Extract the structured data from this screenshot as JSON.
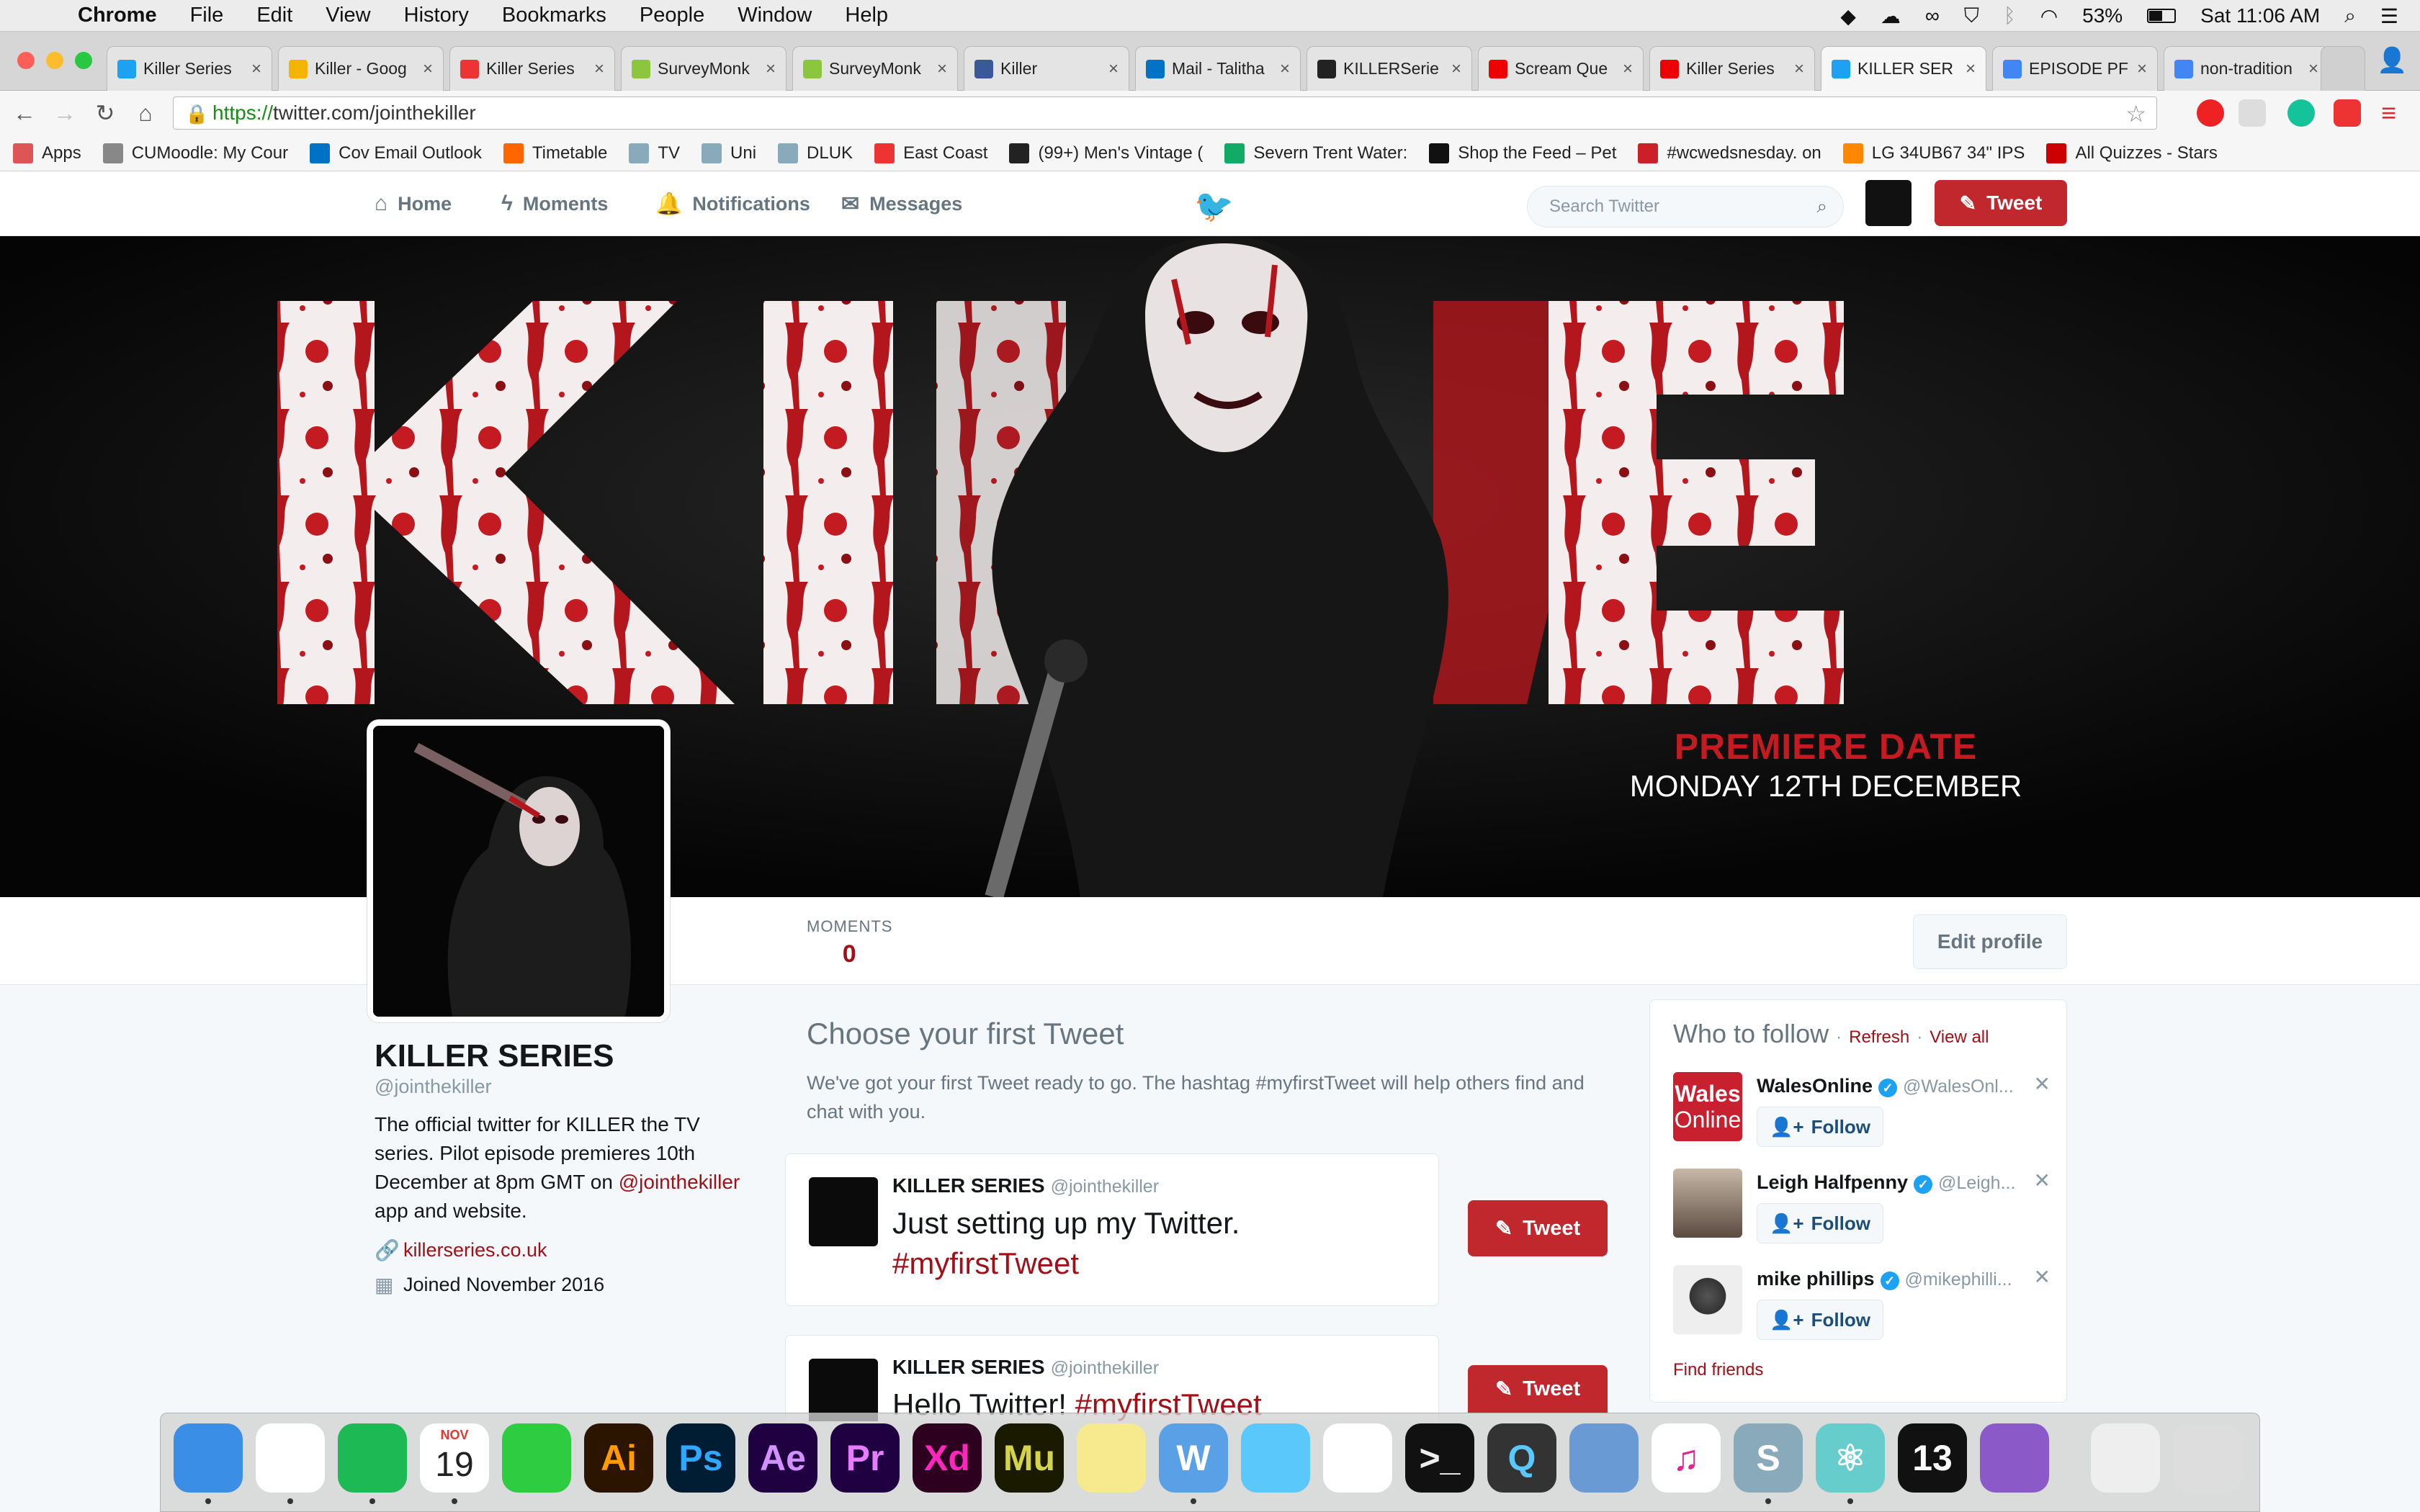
{
  "menubar": {
    "app": "Chrome",
    "items": [
      "File",
      "Edit",
      "View",
      "History",
      "Bookmarks",
      "People",
      "Window",
      "Help"
    ],
    "battery": "53%",
    "clock": "Sat 11:06 AM"
  },
  "tabs": [
    {
      "title": "Killer Series",
      "fav": "#1da1f2"
    },
    {
      "title": "Killer - Goog",
      "fav": "#f4b400"
    },
    {
      "title": "Killer Series",
      "fav": "#e33"
    },
    {
      "title": "SurveyMonk",
      "fav": "#8cc63f"
    },
    {
      "title": "SurveyMonk",
      "fav": "#8cc63f"
    },
    {
      "title": "Killer",
      "fav": "#3b5998"
    },
    {
      "title": "Mail - Talitha",
      "fav": "#0072c6"
    },
    {
      "title": "KILLERSerie",
      "fav": "#222"
    },
    {
      "title": "Scream Que",
      "fav": "#e00"
    },
    {
      "title": "Killer Series",
      "fav": "#e00"
    },
    {
      "title": "KILLER SER",
      "fav": "#1da1f2",
      "active": true
    },
    {
      "title": "EPISODE PF",
      "fav": "#4285f4"
    },
    {
      "title": "non-tradition",
      "fav": "#4285f4"
    }
  ],
  "url": {
    "scheme": "https://",
    "rest": "twitter.com/jointhekiller"
  },
  "bookmarks": [
    {
      "label": "Apps",
      "color": "#d55"
    },
    {
      "label": "CUMoodle: My Cour",
      "color": "#888"
    },
    {
      "label": "Cov Email Outlook",
      "color": "#0072c6"
    },
    {
      "label": "Timetable",
      "color": "#f60"
    },
    {
      "label": "TV",
      "color": "#8ab"
    },
    {
      "label": "Uni",
      "color": "#8ab"
    },
    {
      "label": "DLUK",
      "color": "#8ab"
    },
    {
      "label": "East Coast",
      "color": "#e33"
    },
    {
      "label": "(99+) Men's Vintage (",
      "color": "#222"
    },
    {
      "label": "Severn Trent Water:",
      "color": "#1a6"
    },
    {
      "label": "Shop the Feed – Pet",
      "color": "#111"
    },
    {
      "label": "#wcwedsnesday. on",
      "color": "#cb2027"
    },
    {
      "label": "LG 34UB67 34\" IPS",
      "color": "#f80"
    },
    {
      "label": "All Quizzes - Stars",
      "color": "#c00"
    }
  ],
  "twitter": {
    "nav": [
      "Home",
      "Moments",
      "Notifications",
      "Messages"
    ],
    "search_placeholder": "Search Twitter",
    "tweet_label": "Tweet"
  },
  "banner": {
    "title": "KILLER",
    "premiere_label": "PREMIERE DATE",
    "premiere_date": "MONDAY 12TH DECEMBER"
  },
  "profile": {
    "moments_label": "MOMENTS",
    "moments_count": "0",
    "edit_label": "Edit profile",
    "name": "KILLER SERIES",
    "handle": "@jointhekiller",
    "bio_pre": "The official twitter for KILLER the TV series. Pilot episode premieres 10th December at 8pm GMT on ",
    "bio_link": "@jointhekiller",
    "bio_post": " app and website.",
    "website": "killerseries.co.uk",
    "joined": "Joined November 2016"
  },
  "first_tweet": {
    "heading": "Choose your first Tweet",
    "desc": "We've got your first Tweet ready to go. The hashtag #myfirstTweet will help others find and chat with you.",
    "cards": [
      {
        "name": "KILLER SERIES",
        "handle": "@jointhekiller",
        "text": "Just setting up my Twitter.",
        "hashtag": "#myfirstTweet"
      },
      {
        "name": "KILLER SERIES",
        "handle": "@jointhekiller",
        "text": "Hello Twitter!",
        "hashtag": "#myfirstTweet"
      }
    ]
  },
  "who_to_follow": {
    "heading": "Who to follow",
    "refresh": "Refresh",
    "view_all": "View all",
    "follow_label": "Follow",
    "people": [
      {
        "name": "WalesOnline",
        "handle": "@WalesOnl...",
        "avatar_color": "#c8202f"
      },
      {
        "name": "Leigh Halfpenny",
        "handle": "@Leigh...",
        "avatar_color": "#6a6058"
      },
      {
        "name": "mike phillips",
        "handle": "@mikephilli...",
        "avatar_color": "#dcdcdc"
      }
    ],
    "find_friends": "Find friends",
    "wales_logo_line1": "Wales",
    "wales_logo_line2": "Online"
  },
  "dock": {
    "calendar_month": "NOV",
    "calendar_day": "19",
    "apps": [
      {
        "name": "finder",
        "label": "",
        "bg": "#3a8ee6",
        "fg": "#fff"
      },
      {
        "name": "chrome",
        "label": "",
        "bg": "#fff",
        "fg": "#000"
      },
      {
        "name": "spotify",
        "label": "",
        "bg": "#1db954",
        "fg": "#000"
      },
      {
        "name": "calendar",
        "label": "",
        "bg": "#fff",
        "fg": "#000"
      },
      {
        "name": "facetime",
        "label": "",
        "bg": "#2ecc40",
        "fg": "#fff"
      },
      {
        "name": "illustrator",
        "label": "Ai",
        "bg": "#2b1500",
        "fg": "#ff9a00"
      },
      {
        "name": "photoshop",
        "label": "Ps",
        "bg": "#001d34",
        "fg": "#31a8ff"
      },
      {
        "name": "after-effects",
        "label": "Ae",
        "bg": "#1f0040",
        "fg": "#d291ff"
      },
      {
        "name": "premiere",
        "label": "Pr",
        "bg": "#1f0040",
        "fg": "#e77cff"
      },
      {
        "name": "xd",
        "label": "Xd",
        "bg": "#2e001f",
        "fg": "#ff26be"
      },
      {
        "name": "muse",
        "label": "Mu",
        "bg": "#1a1a00",
        "fg": "#d4d44c"
      },
      {
        "name": "notes",
        "label": "",
        "bg": "#f7e98e",
        "fg": "#000"
      },
      {
        "name": "word-app",
        "label": "W",
        "bg": "#5aa0e6",
        "fg": "#fff"
      },
      {
        "name": "messages",
        "label": "",
        "bg": "#5ac8fa",
        "fg": "#fff"
      },
      {
        "name": "photos",
        "label": "",
        "bg": "#fff",
        "fg": "#000"
      },
      {
        "name": "terminal",
        "label": ">_",
        "bg": "#111",
        "fg": "#eee"
      },
      {
        "name": "quicktime",
        "label": "Q",
        "bg": "#333",
        "fg": "#5ac8fa"
      },
      {
        "name": "preview",
        "label": "",
        "bg": "#6a9ad4",
        "fg": "#fff"
      },
      {
        "name": "itunes",
        "label": "♫",
        "bg": "#fff",
        "fg": "#e3268f"
      },
      {
        "name": "scrivener",
        "label": "S",
        "bg": "#8ab",
        "fg": "#fff"
      },
      {
        "name": "atom",
        "label": "⚛",
        "bg": "#6cc",
        "fg": "#fff"
      },
      {
        "name": "app-13",
        "label": "13",
        "bg": "#111",
        "fg": "#fff"
      },
      {
        "name": "github",
        "label": "",
        "bg": "#8c5ac8",
        "fg": "#fff"
      },
      {
        "name": "documents",
        "label": "",
        "bg": "#eee",
        "fg": "#000"
      },
      {
        "name": "trash",
        "label": "",
        "bg": "#ddd",
        "fg": "#000"
      }
    ]
  },
  "colors": {
    "accent": "#c0282d",
    "link": "#a30f17",
    "twitter_blue": "#1da1f2"
  }
}
